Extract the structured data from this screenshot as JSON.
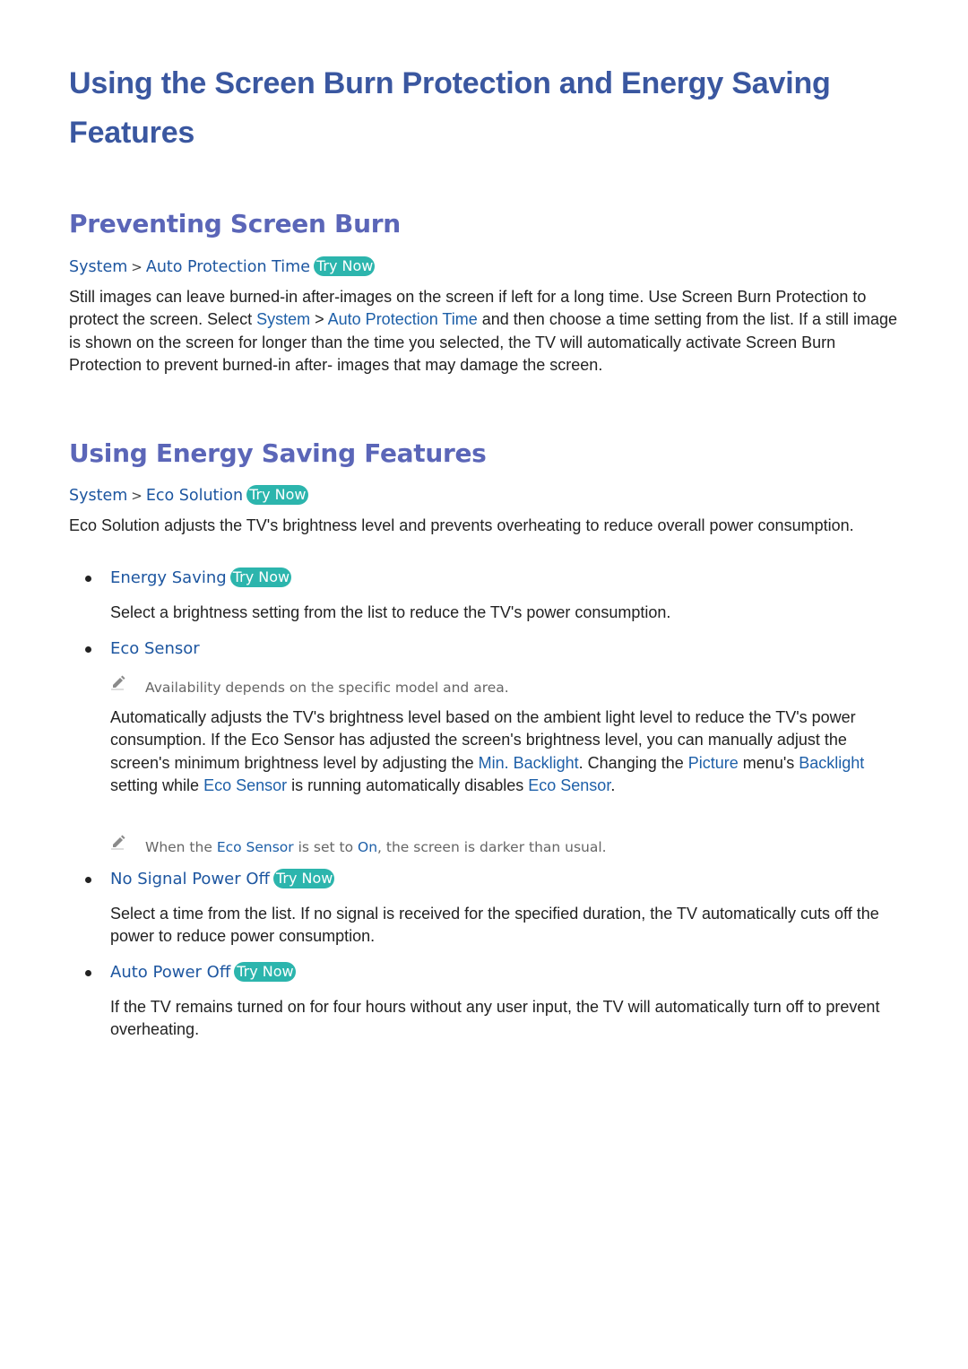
{
  "title": "Using the Screen Burn Protection and Energy Saving Features",
  "title_line1": "Using the Screen Burn Protection and Energy Saving",
  "title_line2": "Features",
  "colors": {
    "title": "#3a57a0",
    "heading": "#5b66b8",
    "link": "#1d5fa8",
    "try_now_bg": "#2cb5ad",
    "body_text": "#222222",
    "note_text": "#666666"
  },
  "sections": [
    {
      "heading": "Preventing Screen Burn",
      "path": {
        "items": [
          "System",
          "Auto Protection Time"
        ],
        "separator": ">",
        "try_now": "Try Now"
      },
      "paragraph": {
        "p1": "Still images can leave burned-in after-images on the screen if left for a long time. Use Screen Burn Protection to protect the screen. Select ",
        "l1": "System",
        "sep": " > ",
        "l2": "Auto Protection Time",
        "p2": " and then choose a time setting from the list. If a still image is shown on the screen for longer than the time you selected, the TV will automatically activate Screen Burn Protection to prevent burned-in after- images that may damage the screen."
      }
    },
    {
      "heading": "Using Energy Saving Features",
      "path": {
        "items": [
          "System",
          "Eco Solution"
        ],
        "separator": ">",
        "try_now": "Try Now"
      },
      "paragraph": "Eco Solution adjusts the TV's brightness level and prevents overheating to reduce overall power consumption.",
      "items": [
        {
          "label": "Energy Saving",
          "try_now": "Try Now",
          "description": "Select a brightness setting from the list to reduce the TV's power consumption."
        },
        {
          "label": "Eco Sensor",
          "note1": "Availability depends on the specific model and area.",
          "description": {
            "p1": "Automatically adjusts the TV's brightness level based on the ambient light level to reduce the TV's power consumption. If the Eco Sensor has adjusted the screen's brightness level, you can manually adjust the screen's minimum brightness level by adjusting the ",
            "l1": "Min. Backlight",
            "p2": ". Changing the ",
            "l2": "Picture",
            "p3": " menu's ",
            "l3": "Backlight",
            "p4": " setting while ",
            "l4": "Eco Sensor",
            "p5": " is running automatically disables ",
            "l5": "Eco Sensor",
            "p6": "."
          },
          "note2": {
            "p1": "When the ",
            "l1": "Eco Sensor",
            "p2": " is set to ",
            "l2": "On",
            "p3": ", the screen is darker than usual."
          }
        },
        {
          "label": "No Signal Power Off",
          "try_now": "Try Now",
          "description": "Select a time from the list. If no signal is received for the specified duration, the TV automatically cuts off the power to reduce power consumption."
        },
        {
          "label": "Auto Power Off",
          "try_now": "Try Now",
          "description": "If the TV remains turned on for four hours without any user input, the TV will automatically turn off to prevent overheating."
        }
      ]
    }
  ],
  "icons": {
    "note": "pencil-icon",
    "bullet": "bullet-dot"
  }
}
